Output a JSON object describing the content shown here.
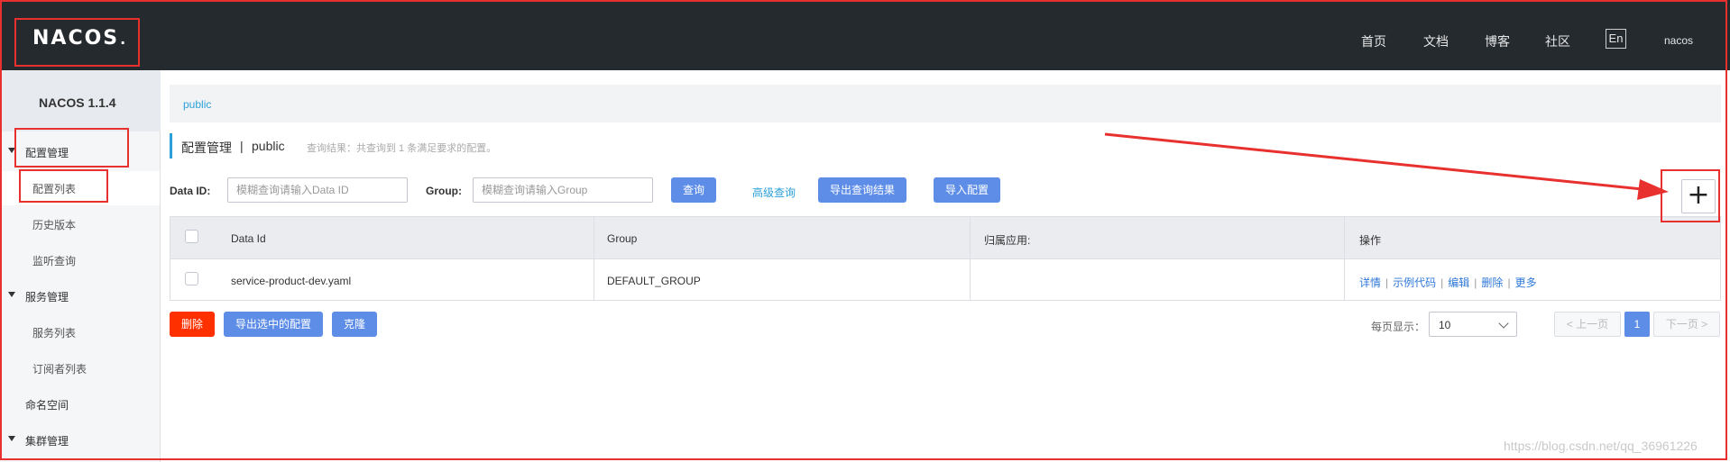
{
  "header": {
    "logo": "NACOS",
    "nav": [
      "首页",
      "文档",
      "博客",
      "社区"
    ],
    "lang": "En",
    "user": "nacos"
  },
  "sidebar": {
    "version": "NACOS 1.1.4",
    "groups": [
      {
        "label": "配置管理",
        "items": [
          "配置列表",
          "历史版本",
          "监听查询"
        ]
      },
      {
        "label": "服务管理",
        "items": [
          "服务列表",
          "订阅者列表"
        ]
      },
      {
        "label": "命名空间",
        "items": []
      },
      {
        "label": "集群管理",
        "items": []
      }
    ]
  },
  "namespace_tab": "public",
  "title": {
    "label": "配置管理",
    "separator": "|",
    "namespace": "public",
    "hint": "查询结果：共查询到 1 条满足要求的配置。"
  },
  "search": {
    "dataid_label": "Data ID:",
    "dataid_placeholder": "模糊查询请输入Data ID",
    "group_label": "Group:",
    "group_placeholder": "模糊查询请输入Group",
    "query_btn": "查询",
    "advanced_link": "高级查询",
    "export_btn": "导出查询结果",
    "import_btn": "导入配置"
  },
  "table": {
    "headers": [
      "Data Id",
      "Group",
      "归属应用:",
      "操作"
    ],
    "rows": [
      {
        "data_id": "service-product-dev.yaml",
        "group": "DEFAULT_GROUP",
        "app": "",
        "ops": [
          "详情",
          "示例代码",
          "编辑",
          "删除",
          "更多"
        ]
      }
    ]
  },
  "footer_actions": {
    "delete_btn": "删除",
    "export_selected_btn": "导出选中的配置",
    "clone_btn": "克隆"
  },
  "pagination": {
    "page_size_label": "每页显示：",
    "page_size": "10",
    "prev": "< 上一页",
    "current": "1",
    "next": "下一页 >"
  },
  "add_button": "+",
  "watermark": "https://blog.csdn.net/qq_36961226",
  "colors": {
    "header_bg": "#252a2f",
    "primary": "#5e8de8",
    "danger": "#ff3000",
    "link": "#2ca0d9",
    "annotation": "#e8302f"
  }
}
